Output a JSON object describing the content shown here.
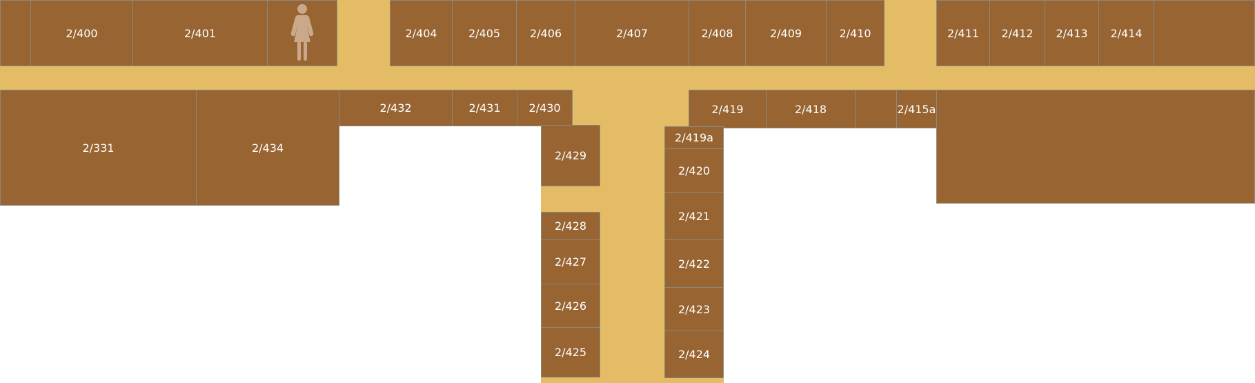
{
  "floor_plan": {
    "colors": {
      "room": "#976432",
      "corridor": "#E5BC66",
      "icon": "#C9A98A",
      "label": "#FFFFFF",
      "border": "#8A8A7E"
    },
    "restroom_icon": "female-restroom-icon",
    "rooms": [
      {
        "id": "r0",
        "label": ""
      },
      {
        "id": "r400",
        "label": "2/400"
      },
      {
        "id": "r401",
        "label": "2/401"
      },
      {
        "id": "r404",
        "label": "2/404"
      },
      {
        "id": "r405",
        "label": "2/405"
      },
      {
        "id": "r406",
        "label": "2/406"
      },
      {
        "id": "r407",
        "label": "2/407"
      },
      {
        "id": "r408",
        "label": "2/408"
      },
      {
        "id": "r409",
        "label": "2/409"
      },
      {
        "id": "r410",
        "label": "2/410"
      },
      {
        "id": "r411",
        "label": "2/411"
      },
      {
        "id": "r412",
        "label": "2/412"
      },
      {
        "id": "r413",
        "label": "2/413"
      },
      {
        "id": "r414",
        "label": "2/414"
      },
      {
        "id": "r414x",
        "label": ""
      },
      {
        "id": "r331",
        "label": "2/331"
      },
      {
        "id": "r434",
        "label": "2/434"
      },
      {
        "id": "r432",
        "label": "2/432"
      },
      {
        "id": "r431",
        "label": "2/431"
      },
      {
        "id": "r430",
        "label": "2/430"
      },
      {
        "id": "r419",
        "label": "2/419"
      },
      {
        "id": "r418",
        "label": "2/418"
      },
      {
        "id": "r418x",
        "label": ""
      },
      {
        "id": "r415a",
        "label": "2/415a"
      },
      {
        "id": "reast",
        "label": ""
      },
      {
        "id": "r429",
        "label": "2/429"
      },
      {
        "id": "r428",
        "label": "2/428"
      },
      {
        "id": "r427",
        "label": "2/427"
      },
      {
        "id": "r426",
        "label": "2/426"
      },
      {
        "id": "r425",
        "label": "2/425"
      },
      {
        "id": "r419a",
        "label": "2/419a"
      },
      {
        "id": "r420",
        "label": "2/420"
      },
      {
        "id": "r421",
        "label": "2/421"
      },
      {
        "id": "r422",
        "label": "2/422"
      },
      {
        "id": "r423",
        "label": "2/423"
      },
      {
        "id": "r424",
        "label": "2/424"
      }
    ]
  }
}
